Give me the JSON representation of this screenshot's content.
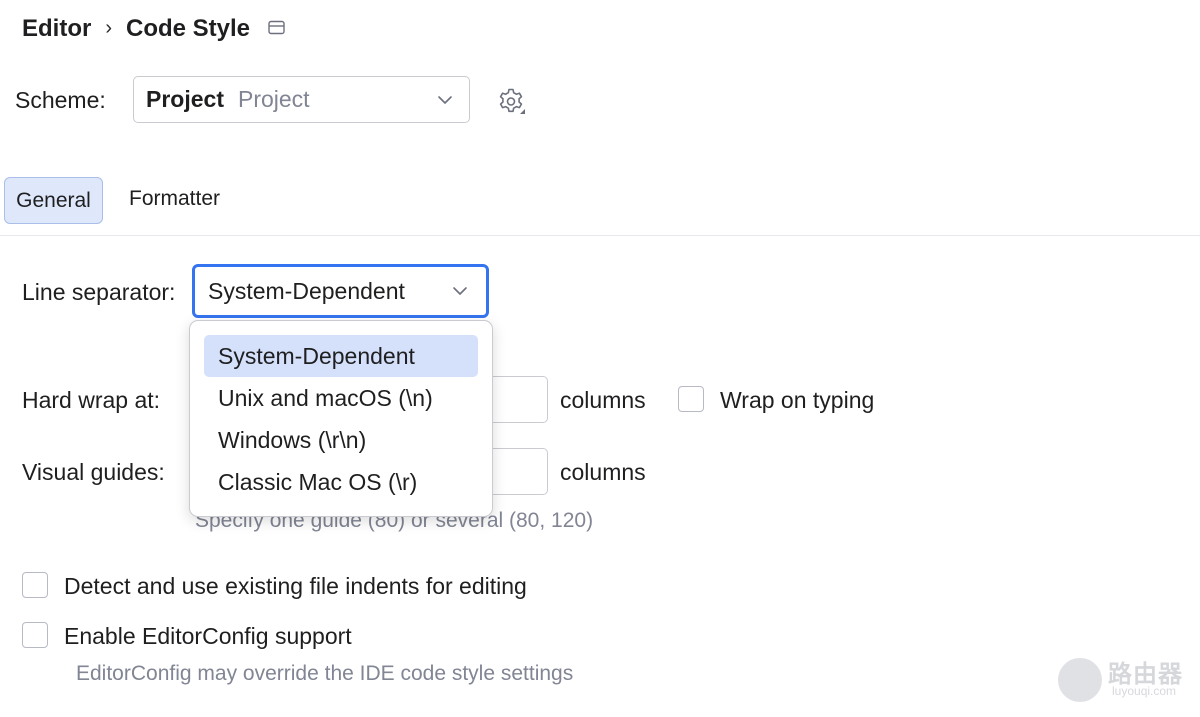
{
  "breadcrumb": {
    "parent": "Editor",
    "separator": "›",
    "current": "Code Style"
  },
  "scheme": {
    "label": "Scheme:",
    "selected_name": "Project",
    "selected_type": "Project"
  },
  "tabs": [
    {
      "label": "General",
      "selected": true
    },
    {
      "label": "Formatter",
      "selected": false
    }
  ],
  "form": {
    "line_separator": {
      "label": "Line separator:",
      "value": "System-Dependent"
    },
    "hard_wrap": {
      "label": "Hard wrap at:",
      "value": "",
      "unit": "columns"
    },
    "wrap_on_typing": {
      "label": "Wrap on typing",
      "checked": false
    },
    "visual_guides": {
      "label": "Visual guides:",
      "value": "",
      "unit": "columns",
      "hint": "Specify one guide (80) or several (80, 120)"
    },
    "detect_indents": {
      "label": "Detect and use existing file indents for editing",
      "checked": false
    },
    "editorconfig": {
      "label": "Enable EditorConfig support",
      "checked": false,
      "hint": "EditorConfig may override the IDE code style settings"
    }
  },
  "line_separator_options": [
    {
      "label": "System-Dependent",
      "selected": true
    },
    {
      "label": "Unix and macOS (\\n)",
      "selected": false
    },
    {
      "label": "Windows (\\r\\n)",
      "selected": false
    },
    {
      "label": "Classic Mac OS (\\r)",
      "selected": false
    }
  ],
  "watermark": {
    "text": "路由器",
    "sub": "luyouqi.com"
  },
  "colors": {
    "accent": "#3574f0",
    "tab_selected_bg": "#dfe8fb",
    "option_selected_bg": "#d5e1fa",
    "hint_text": "#818594"
  },
  "icons": {
    "window": "window-icon",
    "settings": "gear-icon",
    "dropdown": "chevron-down-icon"
  }
}
